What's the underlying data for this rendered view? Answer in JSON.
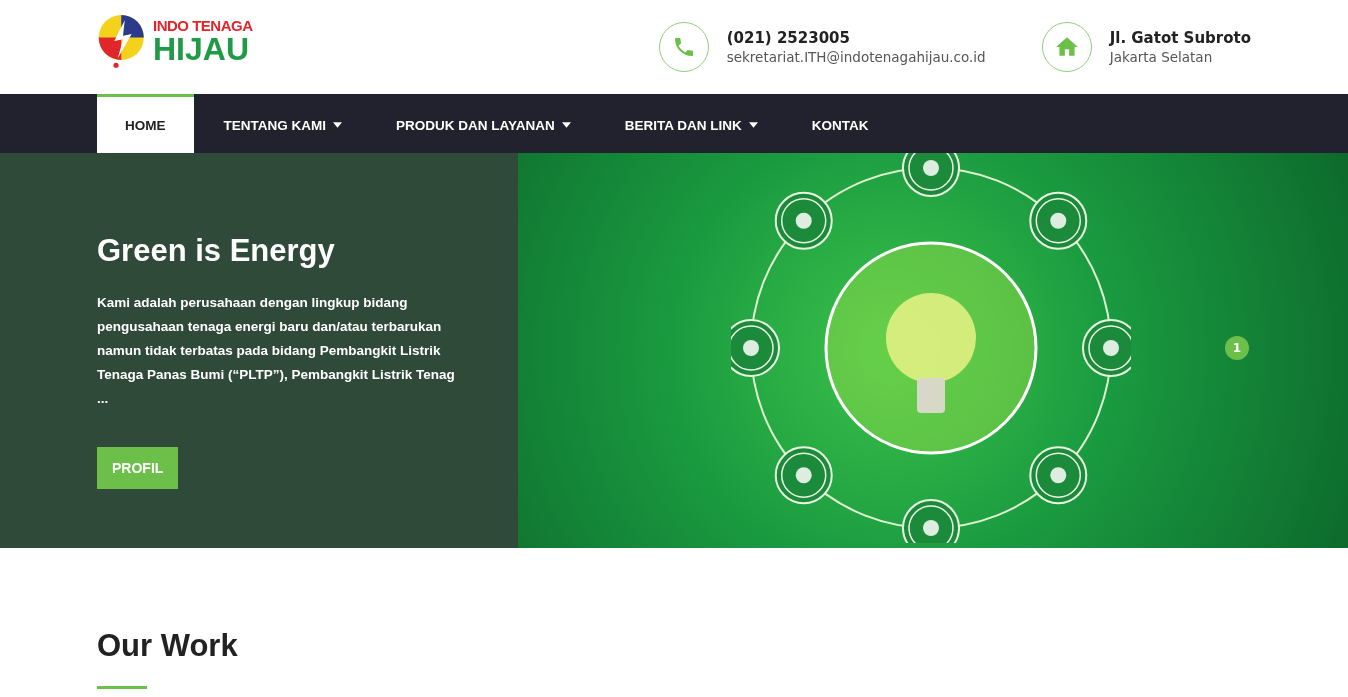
{
  "logo": {
    "top": "INDO TENAGA",
    "bottom": "HIJAU"
  },
  "contacts": [
    {
      "kind": "phone",
      "title": "(021) 2523005",
      "detail": "sekretariat.ITH@indotenagahijau.co.id"
    },
    {
      "kind": "home",
      "title": "Jl. Gatot Subroto",
      "detail": "Jakarta Selatan"
    }
  ],
  "nav": [
    {
      "label": "HOME",
      "selected": true,
      "dropdown": false
    },
    {
      "label": "TENTANG KAMI",
      "selected": false,
      "dropdown": true
    },
    {
      "label": "PRODUK DAN LAYANAN",
      "selected": false,
      "dropdown": true
    },
    {
      "label": "BERITA DAN LINK",
      "selected": false,
      "dropdown": true
    },
    {
      "label": "KONTAK",
      "selected": false,
      "dropdown": false
    }
  ],
  "hero": {
    "title": "Green is Energy",
    "text": "Kami adalah perusahaan dengan lingkup bidang pengusahaan tenaga energi baru dan/atau terbarukan namun tidak terbatas pada bidang Pembangkit Listrik Tenaga Panas Bumi (“PLTP”), Pembangkit Listrik Tenag ...",
    "button": "PROFIL",
    "slides": [
      {
        "label": "1",
        "selected": true
      }
    ]
  },
  "section": {
    "title": "Our Work"
  }
}
